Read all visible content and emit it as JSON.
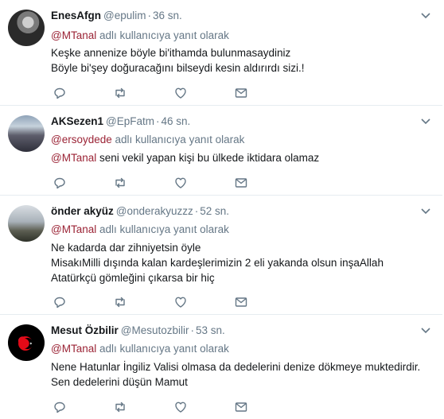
{
  "reply_prefix": "adlı kullanıcıya yanıt olarak",
  "tweets": [
    {
      "name": "EnesAfgn",
      "handle": "@epulim",
      "dot": "·",
      "time": "36 sn.",
      "reply_to": "@MTanal",
      "lines": [
        "Keşke annenize böyle bi'ithamda bulunmasaydiniz",
        "Böyle bi'şey doğuracağını bilseydi kesin aldırırdı sizi.!"
      ]
    },
    {
      "name": "AKSezen1",
      "handle": "@EpFatm",
      "dot": "·",
      "time": "46 sn.",
      "reply_to": "@ersoydede",
      "mention": "@MTanal",
      "lines": [
        "seni vekil yapan kişi bu ülkede iktidara olamaz"
      ]
    },
    {
      "name": "önder akyüz",
      "handle": "@onderakyuzzz",
      "dot": "·",
      "time": "52 sn.",
      "reply_to": "@MTanal",
      "lines": [
        "Ne kadarda dar zihniyetsin öyle",
        "MisakıMilli dışında kalan kardeşlerimizin 2 eli yakanda olsun inşaAllah",
        "Atatürkçü gömleğini çıkarsa bir hiç"
      ]
    },
    {
      "name": "Mesut Özbilir",
      "handle": "@Mesutozbilir",
      "dot": "·",
      "time": "53 sn.",
      "reply_to": "@MTanal",
      "lines": [
        "Nene Hatunlar İngiliz Valisi olmasa da dedelerini denize dökmeye muktedirdir.",
        "Sen dedelerini düşün Mamut"
      ]
    }
  ],
  "colors": {
    "accent": "#9b2335",
    "muted": "#657786",
    "text": "#14171a",
    "border": "#e6ecf0"
  },
  "icons": [
    "reply-icon",
    "retweet-icon",
    "like-icon",
    "message-icon",
    "chevron-down-icon"
  ]
}
